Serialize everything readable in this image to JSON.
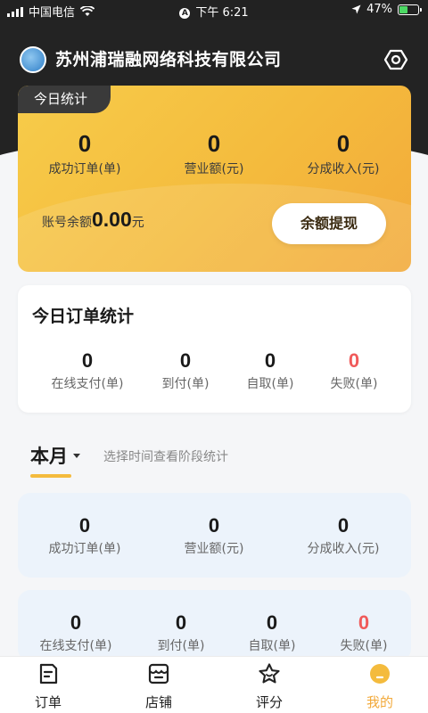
{
  "status_bar": {
    "carrier": "中国电信",
    "time": "下午 6:21",
    "battery": "47%",
    "battery_level": 0.47
  },
  "header": {
    "company_name": "苏州浦瑞融网络科技有限公司"
  },
  "today_stats": {
    "tag": "今日统计",
    "items": [
      {
        "value": "0",
        "label": "成功订单(单)"
      },
      {
        "value": "0",
        "label": "营业额(元)"
      },
      {
        "value": "0",
        "label": "分成收入(元)"
      }
    ],
    "balance_label": "账号余额",
    "balance_value": "0.00",
    "balance_unit": "元",
    "withdraw_label": "余额提现"
  },
  "today_orders": {
    "title": "今日订单统计",
    "items": [
      {
        "value": "0",
        "label": "在线支付(单)"
      },
      {
        "value": "0",
        "label": "到付(单)"
      },
      {
        "value": "0",
        "label": "自取(单)"
      },
      {
        "value": "0",
        "label": "失败(单)"
      }
    ]
  },
  "period": {
    "current": "本月",
    "hint": "选择时间查看阶段统计"
  },
  "month_stats": {
    "items": [
      {
        "value": "0",
        "label": "成功订单(单)"
      },
      {
        "value": "0",
        "label": "营业额(元)"
      },
      {
        "value": "0",
        "label": "分成收入(元)"
      }
    ]
  },
  "month_orders": {
    "items": [
      {
        "value": "0",
        "label": "在线支付(单)"
      },
      {
        "value": "0",
        "label": "到付(单)"
      },
      {
        "value": "0",
        "label": "自取(单)"
      },
      {
        "value": "0",
        "label": "失败(单)"
      }
    ]
  },
  "tabbar": {
    "items": [
      {
        "label": "订单",
        "icon": "order-icon"
      },
      {
        "label": "店铺",
        "icon": "shop-icon"
      },
      {
        "label": "评分",
        "icon": "star-icon"
      },
      {
        "label": "我的",
        "icon": "profile-icon",
        "active": true
      }
    ]
  },
  "colors": {
    "accent": "#f4bb3d",
    "failure": "#f05a5a",
    "header_bg": "#232323"
  }
}
